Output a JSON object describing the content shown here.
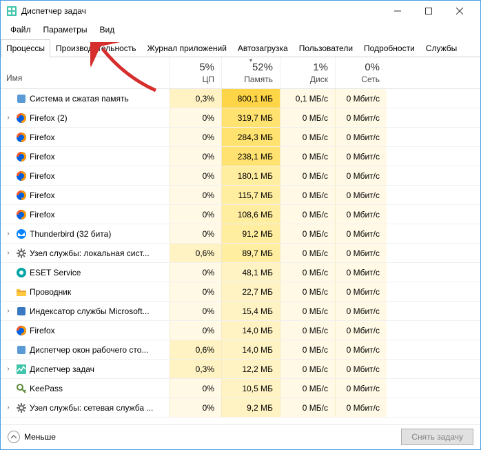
{
  "window": {
    "title": "Диспетчер задач"
  },
  "menu": {
    "file": "Файл",
    "options": "Параметры",
    "view": "Вид"
  },
  "tabs": {
    "processes": "Процессы",
    "performance": "Производительность",
    "app_history": "Журнал приложений",
    "startup": "Автозагрузка",
    "users": "Пользователи",
    "details": "Подробности",
    "services": "Службы"
  },
  "columns": {
    "name": "Имя",
    "cpu_label": "ЦП",
    "cpu_pct": "5%",
    "mem_label": "Память",
    "mem_pct": "52%",
    "disk_label": "Диск",
    "disk_pct": "1%",
    "net_label": "Сеть",
    "net_pct": "0%"
  },
  "processes": [
    {
      "icon": "memory",
      "name": "Система и сжатая память",
      "expand": false,
      "cpu": "0,3%",
      "mem": "800,1 МБ",
      "disk": "0,1 МБ/с",
      "net": "0 Мбит/с",
      "h_cpu": 1,
      "h_mem": 4
    },
    {
      "icon": "firefox",
      "name": "Firefox (2)",
      "expand": true,
      "cpu": "0%",
      "mem": "319,7 МБ",
      "disk": "0 МБ/с",
      "net": "0 Мбит/с",
      "h_cpu": 0,
      "h_mem": 3
    },
    {
      "icon": "firefox",
      "name": "Firefox",
      "expand": false,
      "cpu": "0%",
      "mem": "284,3 МБ",
      "disk": "0 МБ/с",
      "net": "0 Мбит/с",
      "h_cpu": 0,
      "h_mem": 3
    },
    {
      "icon": "firefox",
      "name": "Firefox",
      "expand": false,
      "cpu": "0%",
      "mem": "238,1 МБ",
      "disk": "0 МБ/с",
      "net": "0 Мбит/с",
      "h_cpu": 0,
      "h_mem": 3
    },
    {
      "icon": "firefox",
      "name": "Firefox",
      "expand": false,
      "cpu": "0%",
      "mem": "180,1 МБ",
      "disk": "0 МБ/с",
      "net": "0 Мбит/с",
      "h_cpu": 0,
      "h_mem": 2
    },
    {
      "icon": "firefox",
      "name": "Firefox",
      "expand": false,
      "cpu": "0%",
      "mem": "115,7 МБ",
      "disk": "0 МБ/с",
      "net": "0 Мбит/с",
      "h_cpu": 0,
      "h_mem": 2
    },
    {
      "icon": "firefox",
      "name": "Firefox",
      "expand": false,
      "cpu": "0%",
      "mem": "108,6 МБ",
      "disk": "0 МБ/с",
      "net": "0 Мбит/с",
      "h_cpu": 0,
      "h_mem": 2
    },
    {
      "icon": "thunderbird",
      "name": "Thunderbird (32 бита)",
      "expand": true,
      "cpu": "0%",
      "mem": "91,2 МБ",
      "disk": "0 МБ/с",
      "net": "0 Мбит/с",
      "h_cpu": 0,
      "h_mem": 2
    },
    {
      "icon": "gear",
      "name": "Узел службы: локальная сист...",
      "expand": true,
      "cpu": "0,6%",
      "mem": "89,7 МБ",
      "disk": "0 МБ/с",
      "net": "0 Мбит/с",
      "h_cpu": 1,
      "h_mem": 2
    },
    {
      "icon": "eset",
      "name": "ESET Service",
      "expand": false,
      "cpu": "0%",
      "mem": "48,1 МБ",
      "disk": "0 МБ/с",
      "net": "0 Мбит/с",
      "h_cpu": 0,
      "h_mem": 1
    },
    {
      "icon": "explorer",
      "name": "Проводник",
      "expand": false,
      "cpu": "0%",
      "mem": "22,7 МБ",
      "disk": "0 МБ/с",
      "net": "0 Мбит/с",
      "h_cpu": 0,
      "h_mem": 1
    },
    {
      "icon": "indexer",
      "name": "Индексатор службы Microsoft...",
      "expand": true,
      "cpu": "0%",
      "mem": "15,4 МБ",
      "disk": "0 МБ/с",
      "net": "0 Мбит/с",
      "h_cpu": 0,
      "h_mem": 1
    },
    {
      "icon": "firefox",
      "name": "Firefox",
      "expand": false,
      "cpu": "0%",
      "mem": "14,0 МБ",
      "disk": "0 МБ/с",
      "net": "0 Мбит/с",
      "h_cpu": 0,
      "h_mem": 1
    },
    {
      "icon": "dwm",
      "name": "Диспетчер окон рабочего сто...",
      "expand": false,
      "cpu": "0,6%",
      "mem": "14,0 МБ",
      "disk": "0 МБ/с",
      "net": "0 Мбит/с",
      "h_cpu": 1,
      "h_mem": 1
    },
    {
      "icon": "taskmgr",
      "name": "Диспетчер задач",
      "expand": true,
      "cpu": "0,3%",
      "mem": "12,2 МБ",
      "disk": "0 МБ/с",
      "net": "0 Мбит/с",
      "h_cpu": 1,
      "h_mem": 1
    },
    {
      "icon": "keepass",
      "name": "KeePass",
      "expand": false,
      "cpu": "0%",
      "mem": "10,5 МБ",
      "disk": "0 МБ/с",
      "net": "0 Мбит/с",
      "h_cpu": 0,
      "h_mem": 1
    },
    {
      "icon": "gear",
      "name": "Узел службы: сетевая служба ...",
      "expand": true,
      "cpu": "0%",
      "mem": "9,2 МБ",
      "disk": "0 МБ/с",
      "net": "0 Мбит/с",
      "h_cpu": 0,
      "h_mem": 1
    }
  ],
  "footer": {
    "fewer": "Меньше",
    "end_task": "Снять задачу"
  },
  "icons": {
    "memory": "#5b9bd5",
    "firefox": "#ff9500",
    "thunderbird": "#0a84ff",
    "gear": "#6b6b6b",
    "eset": "#00a5a5",
    "explorer": "#ffc83d",
    "indexer": "#3b78c4",
    "dwm": "#5b9bd5",
    "taskmgr": "#40c4aa",
    "keepass": "#5c8a3a"
  }
}
